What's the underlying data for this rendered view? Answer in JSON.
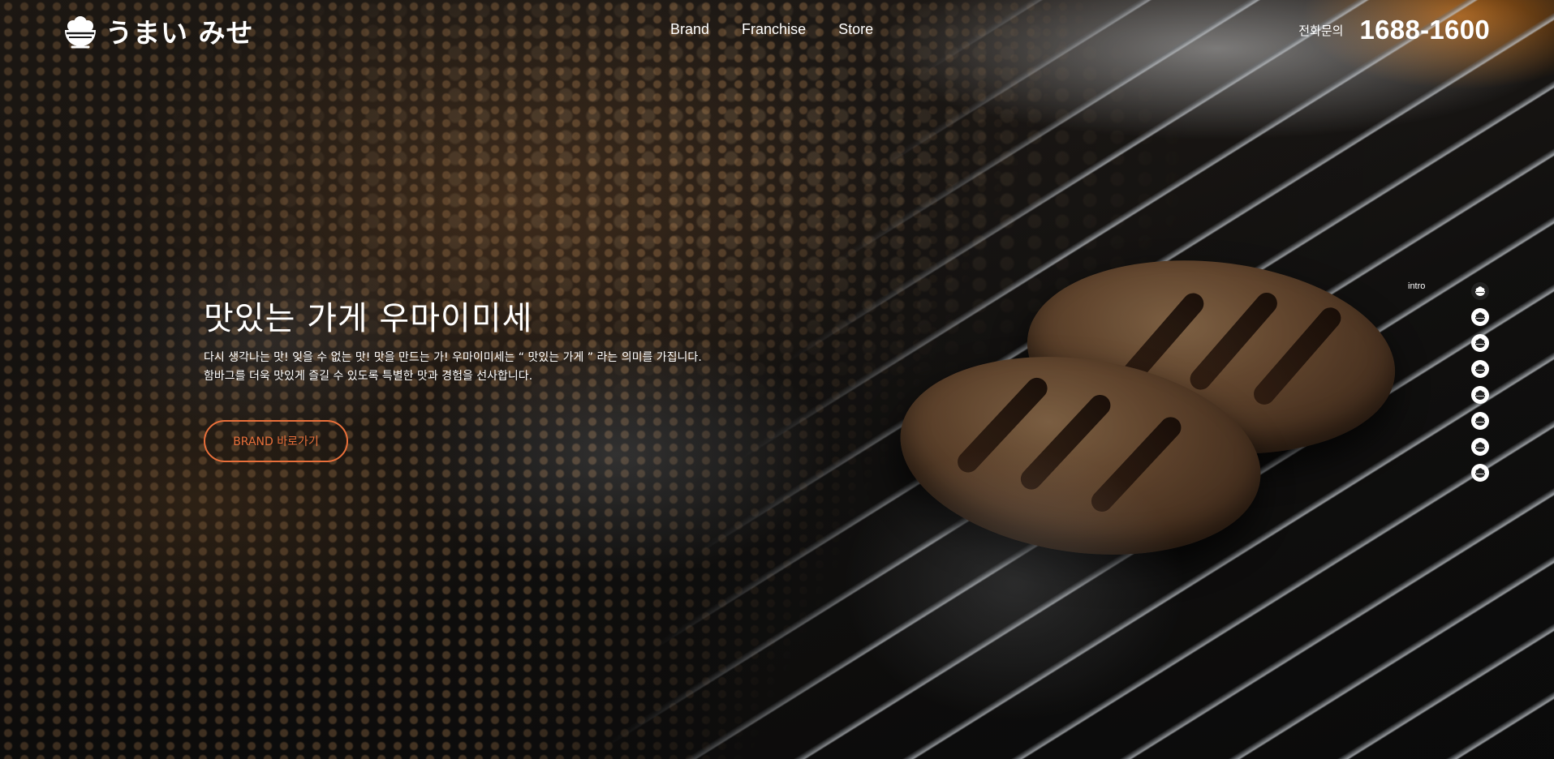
{
  "brand": {
    "logo_text": "うまい みせ",
    "logo_icon": "rice-bowl-icon"
  },
  "nav": {
    "items": [
      {
        "label": "Brand"
      },
      {
        "label": "Franchise"
      },
      {
        "label": "Store"
      }
    ]
  },
  "contact": {
    "label": "전화문의",
    "phone": "1688-1600"
  },
  "hero": {
    "title": "맛있는 가게 우마이미세",
    "description_line1": "다시 생각나는 맛! 잊을 수 없는 맛! 맛을 만드는 가! 우마이미세는 “ 맛있는 가게 ” 라는 의미를 가집니다.",
    "description_line2": "함바그를 더욱 맛있게 즐길 수 있도록 특별한 맛과 경험을 선사합니다.",
    "cta_label": "BRAND 바로가기"
  },
  "pagination": {
    "current_label": "intro",
    "total": 8,
    "active_index": 0,
    "dot_icon": "rice-bowl-icon"
  },
  "colors": {
    "accent": "#e96f3a",
    "text": "#ffffff",
    "dot_active": "#222222",
    "dot_inactive": "#ffffff"
  }
}
